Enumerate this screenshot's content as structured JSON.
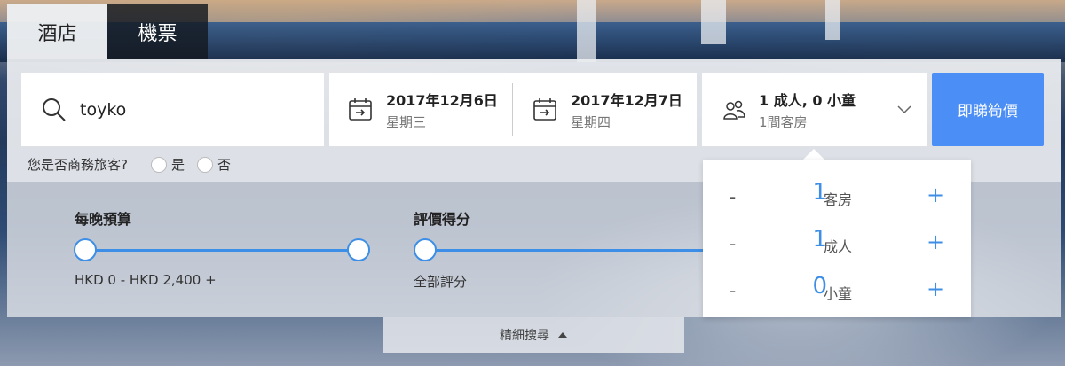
{
  "tabs": [
    {
      "label": "酒店",
      "active": true
    },
    {
      "label": "機票",
      "active": false
    }
  ],
  "search": {
    "value": "toyko",
    "icon": "search-icon"
  },
  "dates": {
    "checkin": {
      "date": "2017年12月6日",
      "weekday": "星期三"
    },
    "checkout": {
      "date": "2017年12月7日",
      "weekday": "星期四"
    }
  },
  "guests": {
    "summary": "1 成人, 0 小童",
    "rooms": "1間客房"
  },
  "search_button": "即睇筍價",
  "business": {
    "question": "您是否商務旅客?",
    "yes": "是",
    "no": "否"
  },
  "filters": {
    "budget": {
      "label": "每晚預算",
      "range": "HKD 0 - HKD 2,400 +",
      "min_fraction": 0,
      "max_fraction": 1
    },
    "rating": {
      "label": "評價得分",
      "value": "全部評分"
    }
  },
  "guest_dropdown": {
    "rows": [
      {
        "minus": "-",
        "count": "1",
        "unit": "客房",
        "plus": "+"
      },
      {
        "minus": "-",
        "count": "1",
        "unit": "成人",
        "plus": "+"
      },
      {
        "minus": "-",
        "count": "0",
        "unit": "小童",
        "plus": "+"
      }
    ]
  },
  "refine_label": "精細搜尋",
  "colors": {
    "accent": "#4b8ef5",
    "slider": "#3d8ee6"
  }
}
